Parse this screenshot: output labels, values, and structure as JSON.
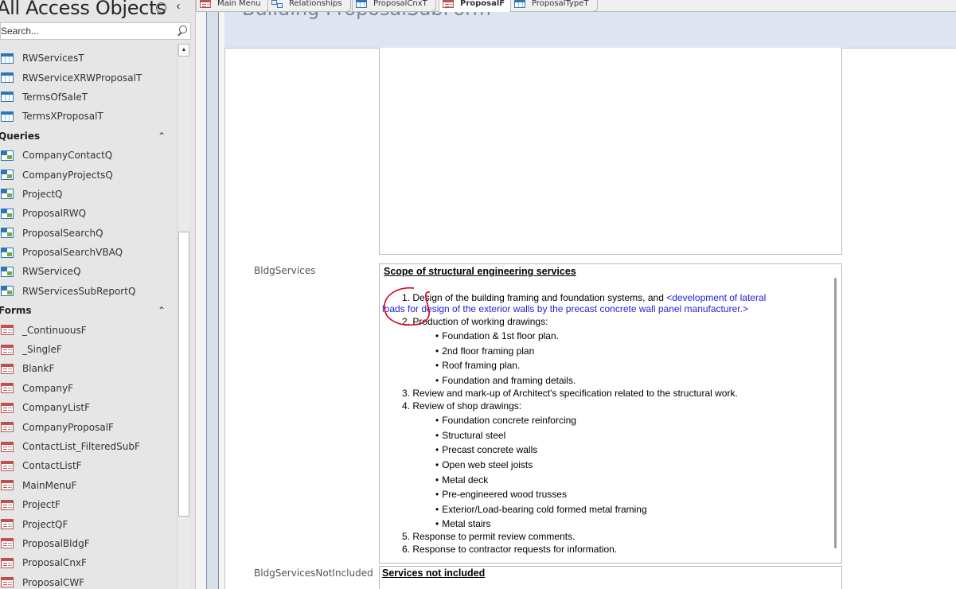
{
  "nav": {
    "title": "All Access Objects",
    "search_placeholder": "Search...",
    "tables": [
      "RWServicesT",
      "RWServiceXRWProposalT",
      "TermsOfSaleT",
      "TermsXProposalT"
    ],
    "queries_label": "Queries",
    "queries": [
      "CompanyContactQ",
      "CompanyProjectsQ",
      "ProjectQ",
      "ProposalRWQ",
      "ProposalSearchQ",
      "ProposalSearchVBAQ",
      "RWServiceQ",
      "RWServicesSubReportQ"
    ],
    "forms_label": "Forms",
    "forms": [
      "_ContinuousF",
      "_SingleF",
      "BlankF",
      "CompanyF",
      "CompanyListF",
      "CompanyProposalF",
      "ContactList_FilteredSubF",
      "ContactListF",
      "MainMenuF",
      "ProjectF",
      "ProjectQF",
      "ProposalBldgF",
      "ProposalCnxF",
      "ProposalCWF"
    ]
  },
  "tabs": [
    "Main Menu",
    "Relationships",
    "ProposalCnxT",
    "ProposalF",
    "ProposalTypeT"
  ],
  "active_tab": "ProposalF",
  "form": {
    "header_title": "Building ProposalSubForm",
    "bldg_services_label": "BldgServices",
    "bldg_services_not_included_label": "BldgServicesNotIncluded",
    "services": {
      "heading": "Scope of structural engineering services",
      "item1_a": "1. Design of the building framing and foundation systems, and ",
      "item1_b": "<development of lateral",
      "item1_c": "loads for design of the exterior walls by the precast concrete wall panel manufacturer.>",
      "item2": "2. Production of working drawings:",
      "item2_bullets": [
        "Foundation & 1st floor plan.",
        "2nd floor framing plan",
        "Roof framing plan.",
        "Foundation and framing details."
      ],
      "item3": "3. Review and mark-up of Architect's specification related to the structural work.",
      "item4": "4. Review of shop drawings:",
      "item4_bullets": [
        "Foundation concrete reinforcing",
        "Structural steel",
        "Precast concrete walls",
        "Open web steel joists",
        "Metal deck",
        "Pre-engineered wood trusses",
        "Exterior/Load-bearing cold formed metal framing",
        "Metal stairs"
      ],
      "item5": "5. Response to permit review comments.",
      "item6": "6. Response to contractor requests for information."
    },
    "not_included_heading": "Services not included"
  },
  "colors": {
    "nav_bg": "#e6e6e6",
    "header_bg": "#dee5f0",
    "link_blue": "#1f1fdc",
    "annotation_red": "#d0021b"
  }
}
